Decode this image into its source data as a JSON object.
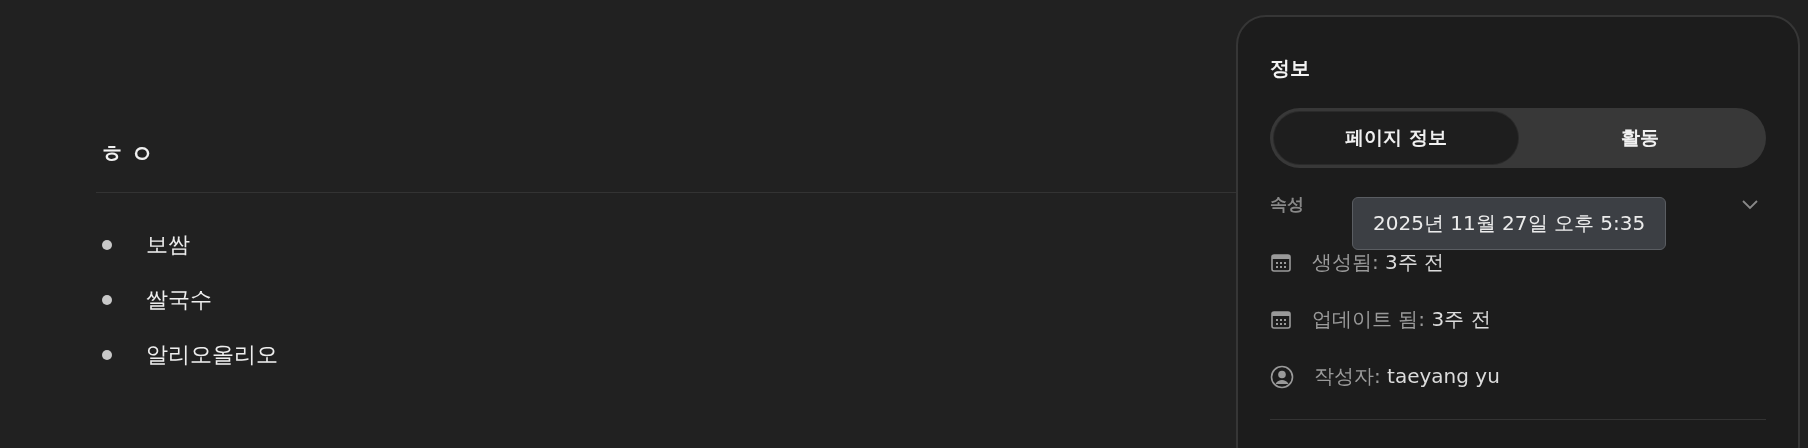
{
  "page": {
    "heading": "ㅎㅇ",
    "items": [
      "보쌈",
      "쌀국수",
      "알리오올리오"
    ]
  },
  "info_panel": {
    "title": "정보",
    "tabs": [
      {
        "label": "페이지 정보",
        "selected": true
      },
      {
        "label": "활동",
        "selected": false
      }
    ],
    "section": {
      "label": "속성",
      "expanded": true
    },
    "tooltip": "2025년 11월 27일 오후 5:35",
    "properties": [
      {
        "kind": "date",
        "label": "생성됨:",
        "value": "3주 전"
      },
      {
        "kind": "date",
        "label": "업데이트 됨:",
        "value": "3주 전"
      },
      {
        "kind": "person",
        "label": "작성자:",
        "value": "taeyang yu"
      }
    ]
  }
}
